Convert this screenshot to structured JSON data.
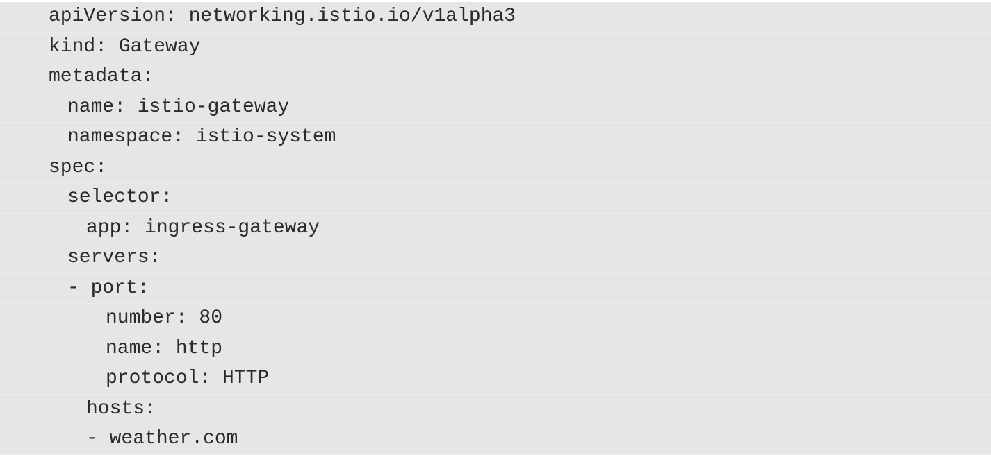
{
  "code_lines": [
    "apiVersion: networking.istio.io/v1alpha3",
    "kind: Gateway",
    "metadata:",
    "name: istio-gateway",
    "namespace: istio-system",
    "spec:",
    "selector:",
    "app: ingress-gateway",
    "servers:",
    "- port:",
    "number: 80",
    "name: http",
    "protocol: HTTP",
    "hosts:",
    "- weather.com"
  ]
}
